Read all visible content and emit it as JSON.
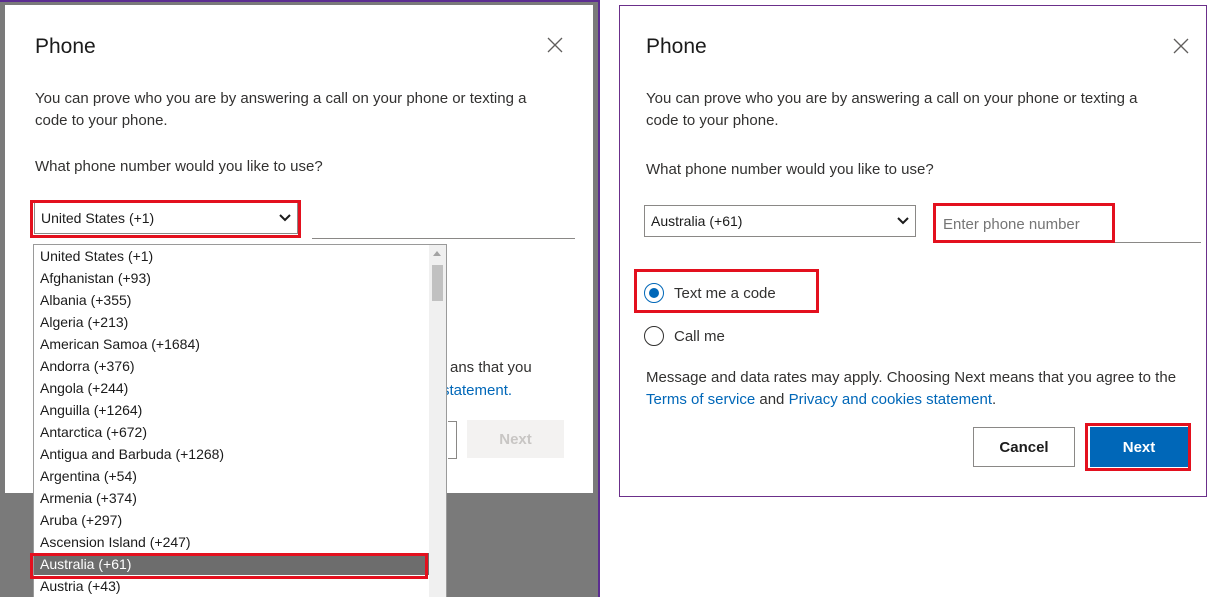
{
  "left": {
    "title": "Phone",
    "description": "You can prove who you are by answering a call on your phone or texting a code to your phone.",
    "question": "What phone number would you like to use?",
    "country_select_value": "United States (+1)",
    "countries": [
      "United States (+1)",
      "Afghanistan (+93)",
      "Albania (+355)",
      "Algeria (+213)",
      "American Samoa (+1684)",
      "Andorra (+376)",
      "Angola (+244)",
      "Anguilla (+1264)",
      "Antarctica (+672)",
      "Antigua and Barbuda (+1268)",
      "Argentina (+54)",
      "Armenia (+374)",
      "Aruba (+297)",
      "Ascension Island (+247)",
      "Australia (+61)",
      "Austria (+43)"
    ],
    "selected_country": "Australia (+61)",
    "partial_line1": "ans that you",
    "partial_line2": "statement.",
    "next_label": "Next"
  },
  "right": {
    "title": "Phone",
    "description": "You can prove who you are by answering a call on your phone or texting a code to your phone.",
    "question": "What phone number would you like to use?",
    "country_select_value": "Australia (+61)",
    "phone_placeholder": "Enter phone number",
    "option_text": "Text me a code",
    "option_call": "Call me",
    "selected_option": "Text me a code",
    "terms_prefix": "Message and data rates may apply. Choosing Next means that you agree to the ",
    "terms_link": "Terms of service",
    "terms_and": " and ",
    "privacy_link": "Privacy and cookies statement",
    "terms_suffix": ".",
    "cancel_label": "Cancel",
    "next_label": "Next"
  },
  "colors": {
    "accent": "#0067b8",
    "highlight": "#e3101e",
    "frame_purple": "#5c2d91"
  },
  "icons": [
    "close-icon",
    "chevron-down-icon",
    "scroll-up-arrow-icon"
  ]
}
